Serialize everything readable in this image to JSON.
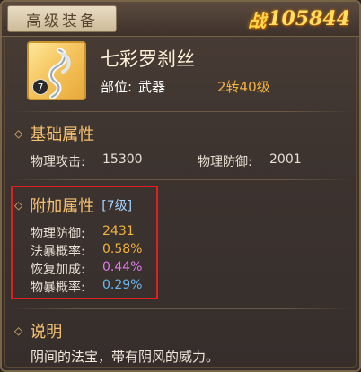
{
  "header": {
    "tab_label": "高级装备",
    "power_icon": "战",
    "power_value": "105844"
  },
  "item": {
    "icon": "silk-scarf-icon",
    "refine_badge": "7",
    "name": "七彩罗刹丝",
    "slot_label": "部位:",
    "slot_value": "武器",
    "level": "2转40级"
  },
  "base_attributes": {
    "title": "基础属性",
    "items": [
      {
        "label": "物理攻击:",
        "value": "15300"
      },
      {
        "label": "物理防御:",
        "value": "2001"
      }
    ]
  },
  "extra_attributes": {
    "title": "附加属性",
    "grade": "[7级]",
    "items": [
      {
        "label": "物理防御:",
        "value": "2431",
        "color": "#f2b240"
      },
      {
        "label": "法暴概率:",
        "value": "0.58%",
        "color": "#f2b240"
      },
      {
        "label": "恢复加成:",
        "value": "0.44%",
        "color": "#e07ae8"
      },
      {
        "label": "物暴概率:",
        "value": "0.29%",
        "color": "#6ab8f0"
      }
    ]
  },
  "description": {
    "title": "说明",
    "text": "阴间的法宝，带有阴风的威力。"
  },
  "colors": {
    "accent_gold": "#f4c070",
    "highlight_red": "#e02020"
  }
}
